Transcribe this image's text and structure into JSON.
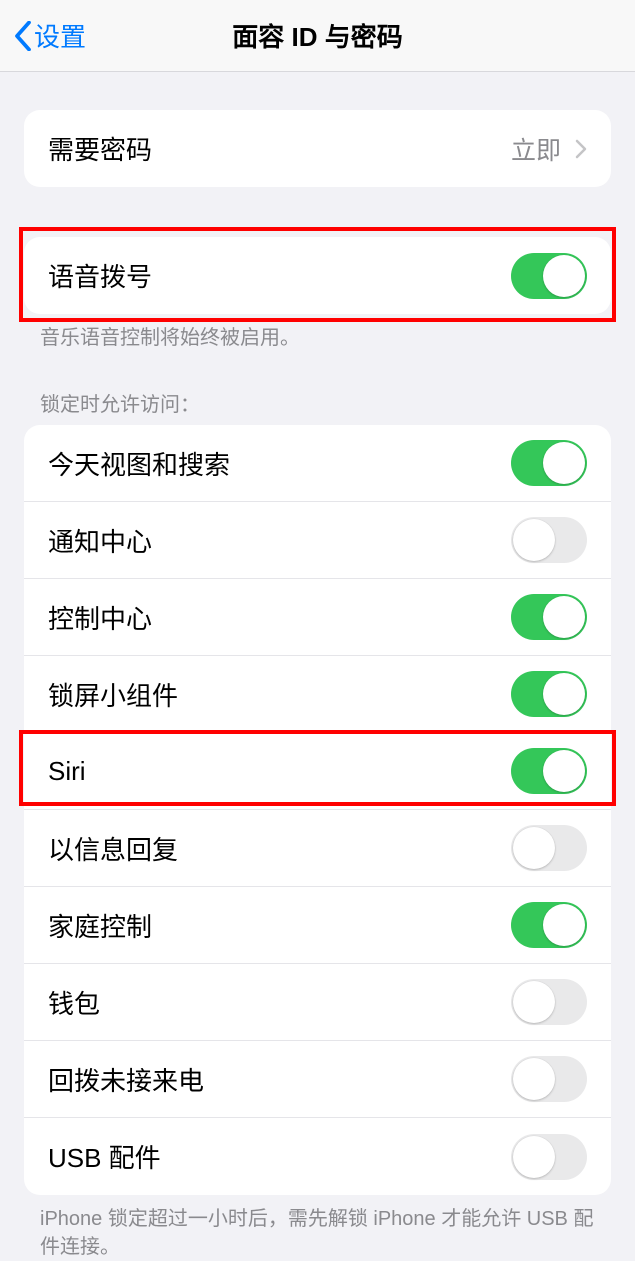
{
  "header": {
    "back_label": "设置",
    "title": "面容 ID 与密码"
  },
  "passcode_group": {
    "require_label": "需要密码",
    "require_value": "立即"
  },
  "voice_dial": {
    "label": "语音拨号",
    "enabled": true,
    "footnote": "音乐语音控制将始终被启用。"
  },
  "lock_section_header": "锁定时允许访问：",
  "lock_access": [
    {
      "label": "今天视图和搜索",
      "enabled": true
    },
    {
      "label": "通知中心",
      "enabled": false
    },
    {
      "label": "控制中心",
      "enabled": true
    },
    {
      "label": "锁屏小组件",
      "enabled": true
    },
    {
      "label": "Siri",
      "enabled": true
    },
    {
      "label": "以信息回复",
      "enabled": false
    },
    {
      "label": "家庭控制",
      "enabled": true
    },
    {
      "label": "钱包",
      "enabled": false
    },
    {
      "label": "回拨未接来电",
      "enabled": false
    },
    {
      "label": "USB 配件",
      "enabled": false
    }
  ],
  "usb_footnote": "iPhone 锁定超过一小时后，需先解锁 iPhone 才能允许 USB 配件连接。"
}
